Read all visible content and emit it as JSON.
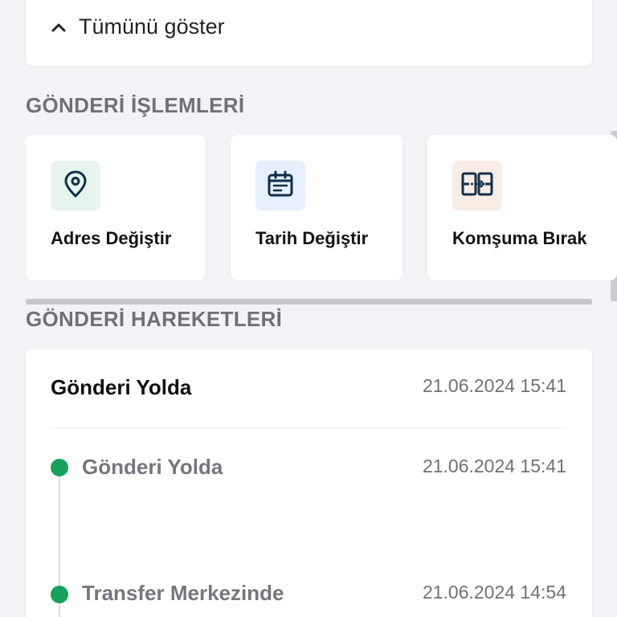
{
  "show_all": {
    "label": "Tümünü göster",
    "icon": "chevron-up-icon"
  },
  "operations": {
    "title": "GÖNDERİ İŞLEMLERİ",
    "items": [
      {
        "label": "Adres Değiştir",
        "icon": "location-pin-icon",
        "icon_bg": "#e7f4ee",
        "icon_color": "#0f2f4a"
      },
      {
        "label": "Tarih Değiştir",
        "icon": "calendar-icon",
        "icon_bg": "#e6effb",
        "icon_color": "#0f2f4a"
      },
      {
        "label": "Komşuma Bırak",
        "icon": "neighbor-transfer-icon",
        "icon_bg": "#f8ece4",
        "icon_color": "#0f2f4a"
      }
    ]
  },
  "movements": {
    "title": "GÖNDERİ HAREKETLERİ",
    "current_status": "Gönderi Yolda",
    "current_date": "21.06.2024 15:41",
    "events": [
      {
        "title": "Gönderi Yolda",
        "date": "21.06.2024 15:41",
        "dot_color": "#17a15c"
      },
      {
        "title": "Transfer Merkezinde",
        "date": "21.06.2024 14:54",
        "dot_color": "#17a15c"
      }
    ]
  }
}
